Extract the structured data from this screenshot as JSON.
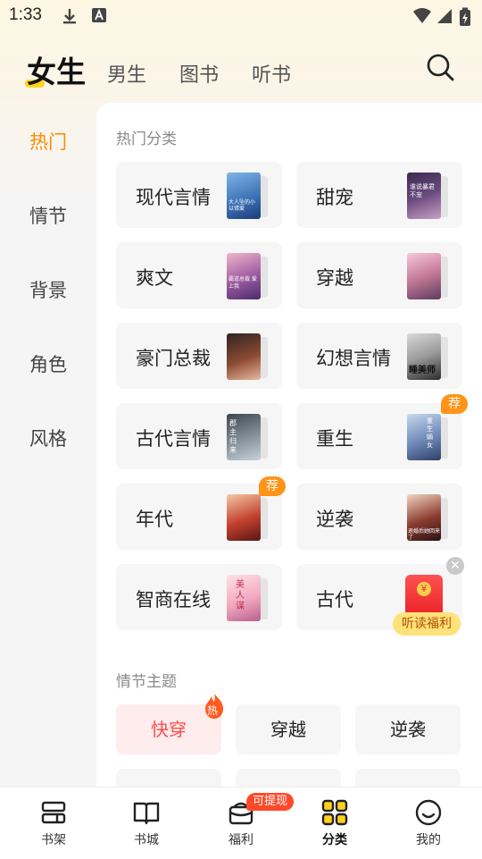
{
  "status_bar": {
    "time": "1:33",
    "icons": [
      "download-icon",
      "font-a-icon",
      "wifi-icon",
      "signal-icon",
      "battery-icon"
    ]
  },
  "top_tabs": [
    {
      "label": "女生",
      "active": true
    },
    {
      "label": "男生",
      "active": false
    },
    {
      "label": "图书",
      "active": false
    },
    {
      "label": "听书",
      "active": false
    }
  ],
  "sidebar": {
    "items": [
      "热门",
      "情节",
      "背景",
      "角色",
      "风格"
    ],
    "active_index": 0
  },
  "hot_categories": {
    "title": "热门分类",
    "cards": [
      {
        "label": "现代言情",
        "cover_text": "大人坠的小 以错爱"
      },
      {
        "label": "甜宠",
        "cover_text": "谁说暴君 不宠"
      },
      {
        "label": "爽文",
        "cover_text": "霸道总裁 爱上我"
      },
      {
        "label": "穿越",
        "cover_text": ""
      },
      {
        "label": "豪门总裁",
        "cover_text": ""
      },
      {
        "label": "幻想言情",
        "cover_text": "睡美师"
      },
      {
        "label": "古代言情",
        "cover_text": "郡主归来"
      },
      {
        "label": "重生",
        "cover_text": "重生嫡女",
        "badge": "荐"
      },
      {
        "label": "年代",
        "cover_text": "",
        "badge": "荐"
      },
      {
        "label": "逆袭",
        "cover_text": "退婚后她回来了"
      },
      {
        "label": "智商在线",
        "cover_text": "美人谋"
      },
      {
        "label": "古代",
        "promo": "听读福利"
      }
    ]
  },
  "plot_themes": {
    "title": "情节主题",
    "items": [
      {
        "label": "快穿",
        "active": true,
        "badge": "热"
      },
      {
        "label": "穿越",
        "active": false
      },
      {
        "label": "逆袭",
        "active": false
      }
    ]
  },
  "bottom_nav": [
    {
      "label": "书架",
      "icon": "bookshelf-icon"
    },
    {
      "label": "书城",
      "icon": "open-book-icon"
    },
    {
      "label": "福利",
      "icon": "gift-box-icon",
      "badge": "可提现"
    },
    {
      "label": "分类",
      "icon": "category-grid-icon",
      "active": true
    },
    {
      "label": "我的",
      "icon": "smiley-profile-icon"
    }
  ],
  "colors": {
    "accent": "#ff8a00",
    "tab_underline": "#ffd21c",
    "hot_red": "#ff4a4a",
    "badge_orange": "#ff9416"
  }
}
